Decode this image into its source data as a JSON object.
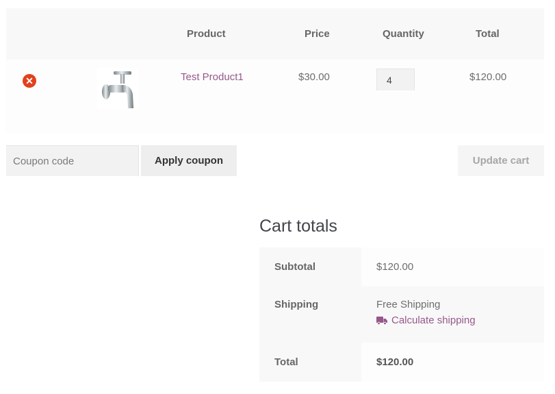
{
  "cart_table": {
    "headers": {
      "remove": "",
      "thumbnail": "",
      "product": "Product",
      "price": "Price",
      "quantity": "Quantity",
      "total": "Total"
    },
    "rows": [
      {
        "remove_icon": "close-circle-icon",
        "thumbnail": "faucet-product-image",
        "product": "Test Product1",
        "price": "$30.00",
        "quantity": "4",
        "total": "$120.00"
      }
    ]
  },
  "actions": {
    "coupon_placeholder": "Coupon code",
    "coupon_value": "",
    "apply_coupon_label": "Apply coupon",
    "update_cart_label": "Update cart"
  },
  "cart_totals": {
    "title": "Cart totals",
    "subtotal_label": "Subtotal",
    "subtotal_value": "$120.00",
    "shipping_label": "Shipping",
    "shipping_value": "Free Shipping",
    "calculate_shipping_label": "Calculate shipping",
    "calculate_shipping_icon": "truck-icon",
    "total_label": "Total",
    "total_value": "$120.00"
  },
  "colors": {
    "link": "#96588a",
    "remove": "#e2401c"
  }
}
